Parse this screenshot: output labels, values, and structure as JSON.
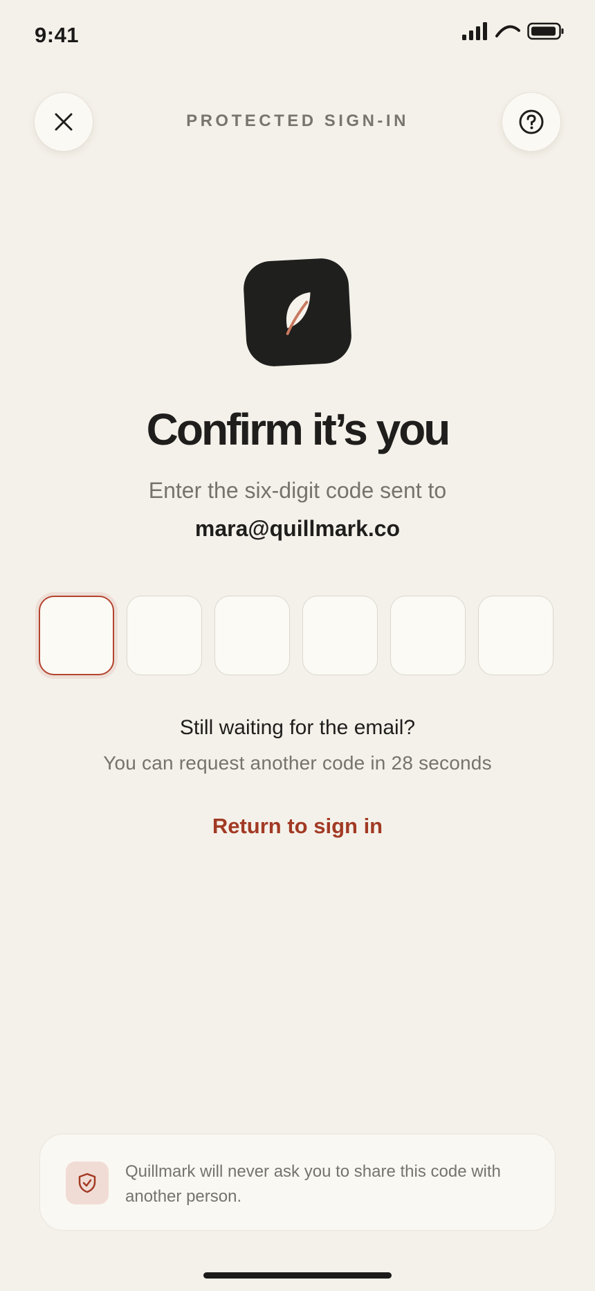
{
  "status_bar": {
    "time": "9:41"
  },
  "header": {
    "title": "PROTECTED SIGN-IN",
    "close_icon": "close-icon",
    "help_icon": "question-icon"
  },
  "logo": {
    "icon": "feather-icon",
    "background_color": "#1f1f1d",
    "accent_color": "#c8795f"
  },
  "main": {
    "title": "Confirm it’s you",
    "subtitle": "Enter the six-digit code sent to",
    "email": "mara@quillmark.co"
  },
  "code_inputs": {
    "digits": [
      "",
      "",
      "",
      "",
      "",
      ""
    ],
    "active_index": 0
  },
  "resend": {
    "heading": "Still waiting for the email?",
    "countdown": "You can request another code in 28 seconds"
  },
  "actions": {
    "return_label": "Return to sign in"
  },
  "notice": {
    "icon": "shield-check-icon",
    "text": "Quillmark will never ask you to share this code with another person."
  },
  "colors": {
    "accent": "#a23a24",
    "background": "#f4f1ea",
    "focus_border": "#b4432e"
  }
}
